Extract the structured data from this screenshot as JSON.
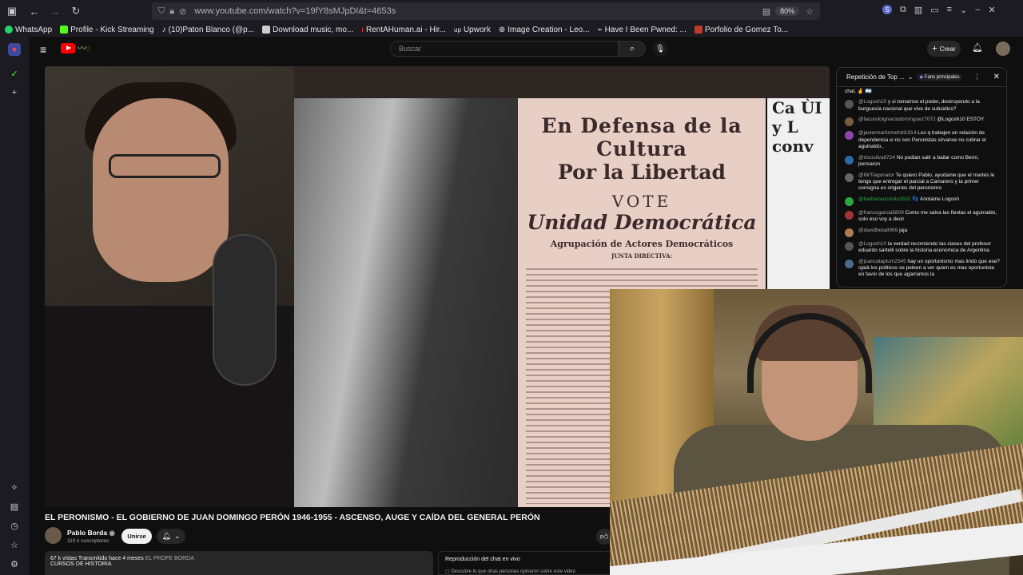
{
  "browser": {
    "url": "www.youtube.com/watch?v=19fY8sMJpDI&t=4653s",
    "zoom": "80%",
    "bookmarks": [
      {
        "label": "WhatsApp",
        "color": "#25d366"
      },
      {
        "label": "Profile - Kick Streaming",
        "color": "#53fc18"
      },
      {
        "label": "(10)Paton Blanco (@p...",
        "color": "#ffffff"
      },
      {
        "label": "Download music, mo...",
        "color": "#cccccc"
      },
      {
        "label": "RentAHuman.ai - Hir...",
        "color": "#ff4040"
      },
      {
        "label": "Upwork",
        "color": "#14a800"
      },
      {
        "label": "Image Creation - Leo...",
        "color": "#8aa0ff"
      },
      {
        "label": "Have I Been Pwned: ...",
        "color": "#dddddd"
      },
      {
        "label": "Porfolio de Gomez To...",
        "color": "#c0392b"
      }
    ]
  },
  "youtube": {
    "search_placeholder": "Buscar",
    "create_label": "Crear"
  },
  "video": {
    "poster_line1": "En Defensa de la Cultura",
    "poster_line2": "Por la Libertad",
    "poster_line3": "VOTE",
    "poster_line4": "Unidad Democrática",
    "poster_line5": "Agrupación de Actores Democráticos",
    "poster_line6": "JUNTA DIRECTIVA:",
    "poster2_text": "Ca ÙI y L conv",
    "title": "EL PERONISMO - EL GOBIERNO DE JUAN DOMINGO PERÓN 1946-1955 - ASCENSO, AUGE Y CAÍDA DEL GENERAL PERÓN"
  },
  "channel": {
    "name": "Pablo Borda",
    "subscribers": "110 k suscriptores",
    "join_label": "Unirse"
  },
  "description": {
    "views": "67 k vistas",
    "when": "Transmitido hace 4 meses",
    "hashtag": "EL PROFE BORDA",
    "line2": "CURSOS DE HISTORIA"
  },
  "chat_replay": {
    "title": "Reproducción del chat en vivo",
    "subtitle": "Descubre lo que otras personas opinaron sobre este video"
  },
  "chat": {
    "header_title": "Repetición de Top ...",
    "badge": "Fans principales",
    "messages": [
      {
        "author": "",
        "text": "chat. ✌ 🇦🇷",
        "color": "#444444",
        "green": false
      },
      {
        "author": "@Logosh10",
        "text": "y si tomamos el poder, destruyendo a la burguesía nacional que vive de subsidios?",
        "color": "#555555",
        "green": false
      },
      {
        "author": "@facundoignaciodominguez7072",
        "text": "@Logosh10 ESTOY",
        "color": "#7a5a3a",
        "green": false
      },
      {
        "author": "@javiermartinmehdi1914",
        "text": "Los q trabajen en relación de dependencia si no son Peronistas sirvanse no cobrar el aguinaldo..",
        "color": "#8e44ad",
        "green": false
      },
      {
        "author": "@nicosilva8724",
        "text": "No podian salir a bailar como Berni, pensaron",
        "color": "#2a6aa8",
        "green": false
      },
      {
        "author": "@MrTiagonator",
        "text": "Te quiero Pablo, ayudame que el martes le tengo que entregar el parcial a Camarero y la primer consigna es origenes del peronismo",
        "color": "#666666",
        "green": false
      },
      {
        "author": "@barbariancriollo2632 👣",
        "text": "Anotame Logosh",
        "color": "#2ba640",
        "green": true
      },
      {
        "author": "@francogarcia5809",
        "text": "Como me salva las fiestas el aguinaldo, solo eso voy a decir",
        "color": "#a33333",
        "green": false
      },
      {
        "author": "@davidbeta8969",
        "text": "jaja",
        "color": "#b07a50",
        "green": false
      },
      {
        "author": "@Logosh10",
        "text": "la verdad recomiendo las clases del profesor eduardo sartelli sobre la historia economica de Argentina",
        "color": "#555555",
        "green": false
      },
      {
        "author": "@juancataplum2545",
        "text": "hay un oportunismo mas lindo que ese? ojalá los politicos se peleen a ver quien es mas oportunista en favor de los que agarramos la",
        "color": "#4a6a8a",
        "green": false
      }
    ]
  }
}
